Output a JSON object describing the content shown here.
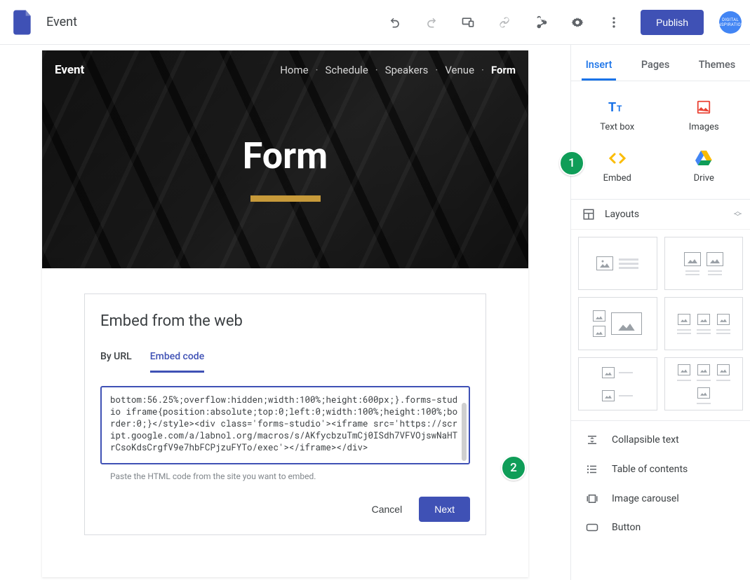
{
  "doc_title": "Event",
  "actions": {
    "publish_label": "Publish",
    "avatar_text": "DIGITAL INSPIRATION"
  },
  "site": {
    "title": "Event",
    "nav": [
      "Home",
      "Schedule",
      "Speakers",
      "Venue",
      "Form"
    ],
    "active_nav": "Form",
    "hero_title": "Form"
  },
  "embed_dialog": {
    "title": "Embed from the web",
    "tabs": {
      "by_url": "By URL",
      "embed_code": "Embed code"
    },
    "active_tab": "Embed code",
    "code": "bottom:56.25%;overflow:hidden;width:100%;height:600px;}.forms-studio iframe{position:absolute;top:0;left:0;width:100%;height:100%;border:0;}</style><div class='forms-studio'><iframe src='https://script.google.com/a/labnol.org/macros/s/AKfycbzuTmCj0ISdh7VFVOjswNaHTrCsoKdsCrgfV9e7hbFCPjzuFYTo/exec'></iframe></div>",
    "helper": "Paste the HTML code from the site you want to embed.",
    "cancel": "Cancel",
    "next": "Next"
  },
  "sidebar": {
    "tabs": [
      "Insert",
      "Pages",
      "Themes"
    ],
    "insert_items": {
      "text_box": "Text box",
      "images": "Images",
      "embed": "Embed",
      "drive": "Drive"
    },
    "layouts_label": "Layouts",
    "tools": {
      "collapsible_text": "Collapsible text",
      "table_of_contents": "Table of contents",
      "image_carousel": "Image carousel",
      "button": "Button"
    }
  },
  "badges": {
    "one": "1",
    "two": "2"
  }
}
